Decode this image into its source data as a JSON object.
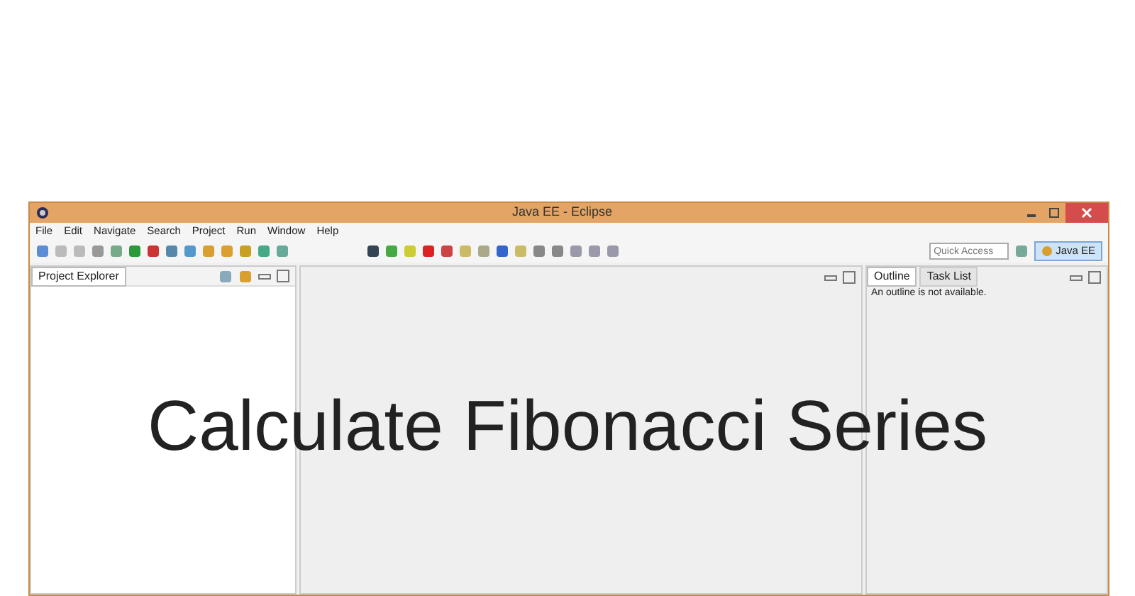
{
  "window": {
    "title": "Java EE - Eclipse"
  },
  "menu": [
    "File",
    "Edit",
    "Navigate",
    "Search",
    "Project",
    "Run",
    "Window",
    "Help"
  ],
  "quick_access": {
    "placeholder": "Quick Access"
  },
  "perspectives": [
    {
      "label": "Java EE",
      "selected": true
    }
  ],
  "left_panel": {
    "tabs": [
      {
        "label": "Project Explorer",
        "selected": true
      }
    ]
  },
  "right_panel": {
    "tabs": [
      {
        "label": "Outline",
        "selected": true
      },
      {
        "label": "Task List",
        "selected": false
      }
    ],
    "message": "An outline is not available."
  },
  "headline": "Calculate Fibonacci Series"
}
